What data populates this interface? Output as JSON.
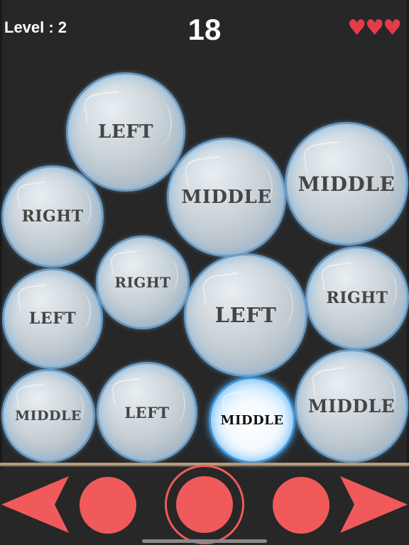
{
  "hud": {
    "level_label": "Level : 2",
    "score": "18",
    "lives": 3,
    "heart_color": "#e33b4b"
  },
  "bubbles": [
    {
      "label": "LEFT",
      "highlighted": false
    },
    {
      "label": "RIGHT",
      "highlighted": false
    },
    {
      "label": "MIDDLE",
      "highlighted": false
    },
    {
      "label": "MIDDLE",
      "highlighted": false
    },
    {
      "label": "RIGHT",
      "highlighted": false
    },
    {
      "label": "LEFT",
      "highlighted": false
    },
    {
      "label": "LEFT",
      "highlighted": false
    },
    {
      "label": "RIGHT",
      "highlighted": false
    },
    {
      "label": "MIDDLE",
      "highlighted": false
    },
    {
      "label": "LEFT",
      "highlighted": false
    },
    {
      "label": "MIDDLE",
      "highlighted": true
    },
    {
      "label": "MIDDLE",
      "highlighted": false
    }
  ],
  "controls": {
    "accent_color": "#f15a5a",
    "buttons": [
      "left-arrow",
      "left-circle",
      "middle-ring",
      "right-circle",
      "right-arrow"
    ]
  }
}
